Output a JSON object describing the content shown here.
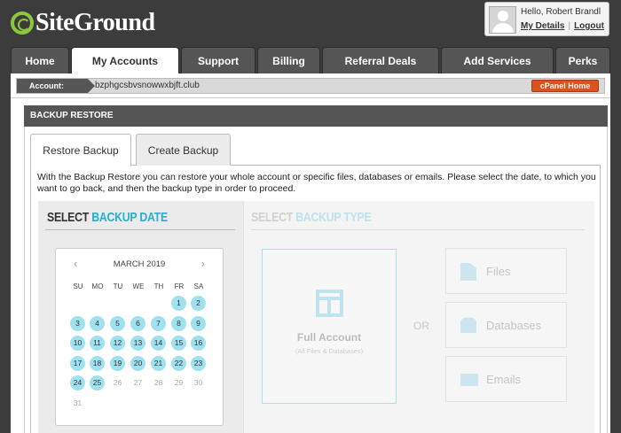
{
  "brand": {
    "name": "SiteGround"
  },
  "user": {
    "greeting": "Hello, Robert Brandl",
    "my_details": "My Details",
    "separator": "|",
    "logout": "Logout"
  },
  "nav": {
    "tabs": [
      {
        "label": "Home"
      },
      {
        "label": "My Accounts"
      },
      {
        "label": "Support"
      },
      {
        "label": "Billing"
      },
      {
        "label": "Referral Deals"
      },
      {
        "label": "Add Services"
      },
      {
        "label": "Perks"
      }
    ],
    "active": "My Accounts"
  },
  "account": {
    "label": "Account:",
    "value": "bzphgcsbvsnowwxbjft.club",
    "cpanel_button": "cPanel Home"
  },
  "section": {
    "title": "BACKUP RESTORE",
    "tabs": [
      {
        "label": "Restore Backup"
      },
      {
        "label": "Create Backup"
      }
    ],
    "active_tab": "Restore Backup",
    "description": "With the Backup Restore you can restore your whole account or specific files, databases or emails. Please select the date, to which you want to go back, and then the backup type in order to proceed."
  },
  "backup_date": {
    "title_a": "SELECT",
    "title_b": "BACKUP DATE",
    "calendar": {
      "month_label": "MARCH 2019",
      "prev": "‹",
      "next": "›",
      "weekdays": [
        "SU",
        "MO",
        "TU",
        "WE",
        "TH",
        "FR",
        "SA"
      ],
      "weeks": [
        [
          "",
          "",
          "",
          "",
          "",
          "1",
          "2"
        ],
        [
          "3",
          "4",
          "5",
          "6",
          "7",
          "8",
          "9"
        ],
        [
          "10",
          "11",
          "12",
          "13",
          "14",
          "15",
          "16"
        ],
        [
          "17",
          "18",
          "19",
          "20",
          "21",
          "22",
          "23"
        ],
        [
          "24",
          "25",
          "26",
          "27",
          "28",
          "29",
          "30"
        ],
        [
          "31",
          "",
          "",
          "",
          "",
          "",
          ""
        ]
      ],
      "available_days": [
        1,
        2,
        3,
        4,
        5,
        6,
        7,
        8,
        9,
        10,
        11,
        12,
        13,
        14,
        15,
        16,
        17,
        18,
        19,
        20,
        21,
        22,
        23,
        24,
        25
      ]
    }
  },
  "backup_type": {
    "title_a": "SELECT",
    "title_b": "BACKUP TYPE",
    "full_account": {
      "label": "Full Account",
      "sublabel": "(All Files & Databases)"
    },
    "or": "OR",
    "options": [
      {
        "label": "Files",
        "icon": "file-icon"
      },
      {
        "label": "Databases",
        "icon": "database-icon"
      },
      {
        "label": "Emails",
        "icon": "envelope-icon"
      }
    ]
  },
  "colors": {
    "accent": "#29aed1",
    "available_day": "#9fe1ef",
    "cpanel_button": "#d9531e",
    "logo_green": "#8dc63f"
  }
}
